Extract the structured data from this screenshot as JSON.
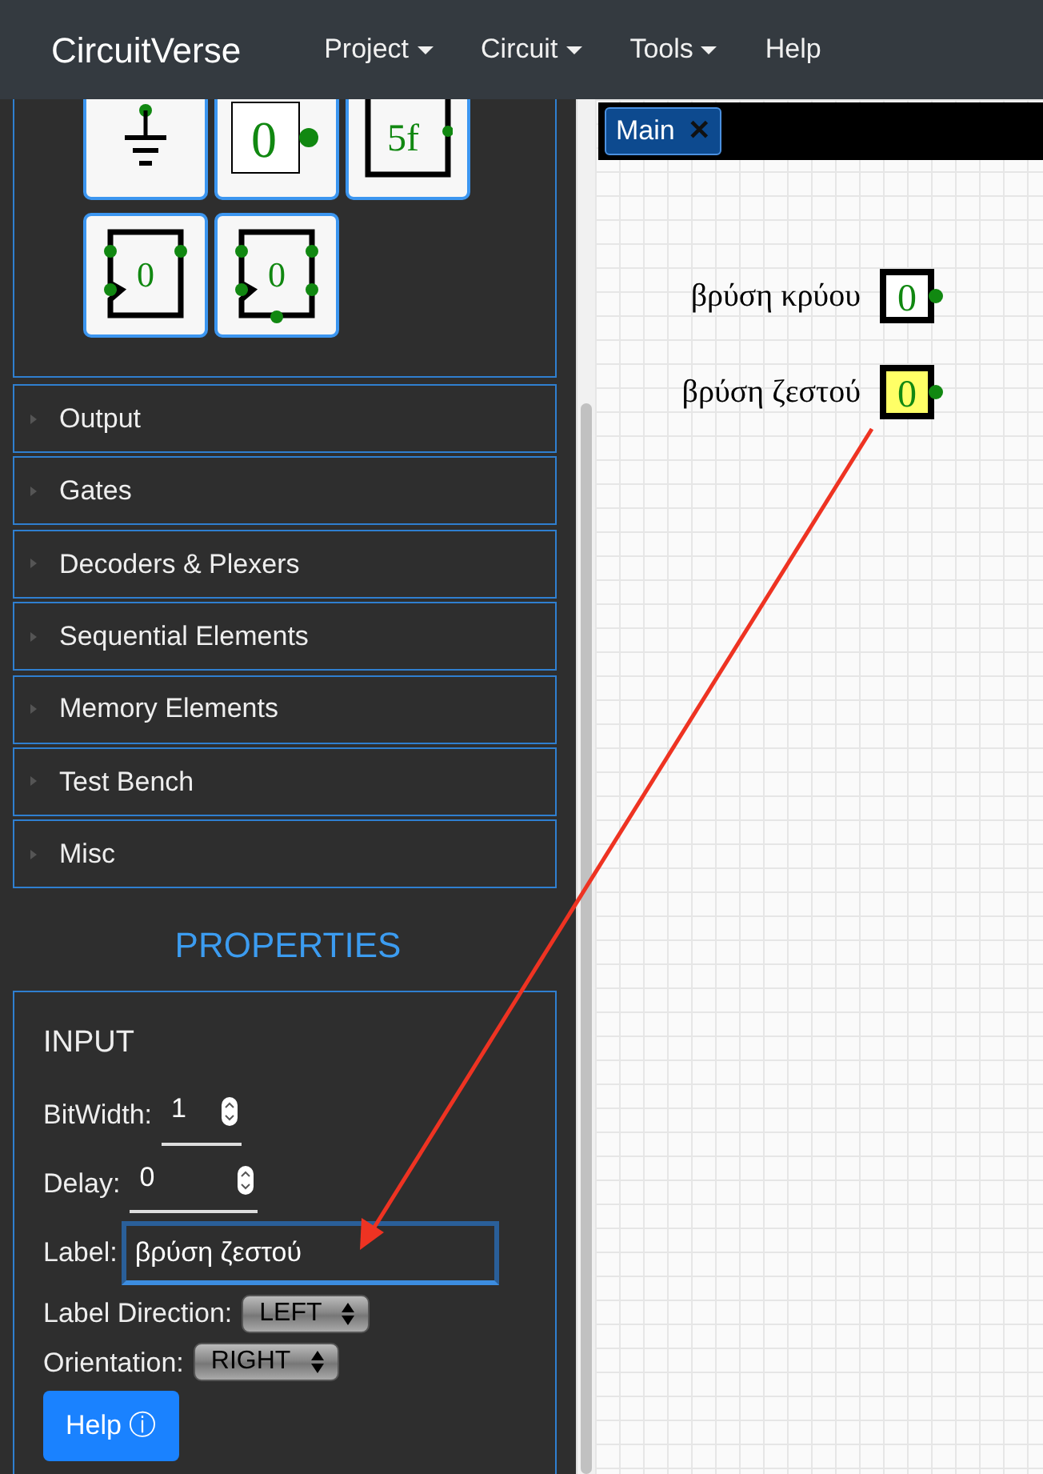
{
  "navbar": {
    "brand": "CircuitVerse",
    "menus": [
      {
        "label": "Project",
        "dropdown": true
      },
      {
        "label": "Circuit",
        "dropdown": true
      },
      {
        "label": "Tools",
        "dropdown": true
      },
      {
        "label": "Help",
        "dropdown": false
      }
    ]
  },
  "palette": {
    "tiles": [
      {
        "kind": "ground"
      },
      {
        "kind": "input",
        "text": "0"
      },
      {
        "kind": "hex",
        "text": "5f"
      },
      {
        "kind": "latch",
        "text": "0"
      },
      {
        "kind": "flipflop",
        "text": "0"
      }
    ],
    "categories": [
      "Output",
      "Gates",
      "Decoders & Plexers",
      "Sequential Elements",
      "Memory Elements",
      "Test Bench",
      "Misc"
    ]
  },
  "properties": {
    "heading": "PROPERTIES",
    "element": "INPUT",
    "fields": [
      {
        "kind": "number",
        "label": "BitWidth:",
        "value": "1"
      },
      {
        "kind": "number",
        "label": "Delay:",
        "value": "0"
      },
      {
        "kind": "text",
        "label": "Label:",
        "value": "βρύση ζεστού",
        "focused": true
      },
      {
        "kind": "select",
        "label": "Label Direction:",
        "value": "LEFT"
      },
      {
        "kind": "select",
        "label": "Orientation:",
        "value": "RIGHT"
      }
    ],
    "help_button": "Help ⓘ"
  },
  "canvas": {
    "tabs": [
      {
        "label": "Main",
        "close": "✕",
        "selected": true
      }
    ],
    "elements": [
      {
        "label": "βρύση κρύου",
        "value": "0",
        "selected": false
      },
      {
        "label": "βρύση ζεστού",
        "value": "0",
        "selected": true
      }
    ]
  }
}
